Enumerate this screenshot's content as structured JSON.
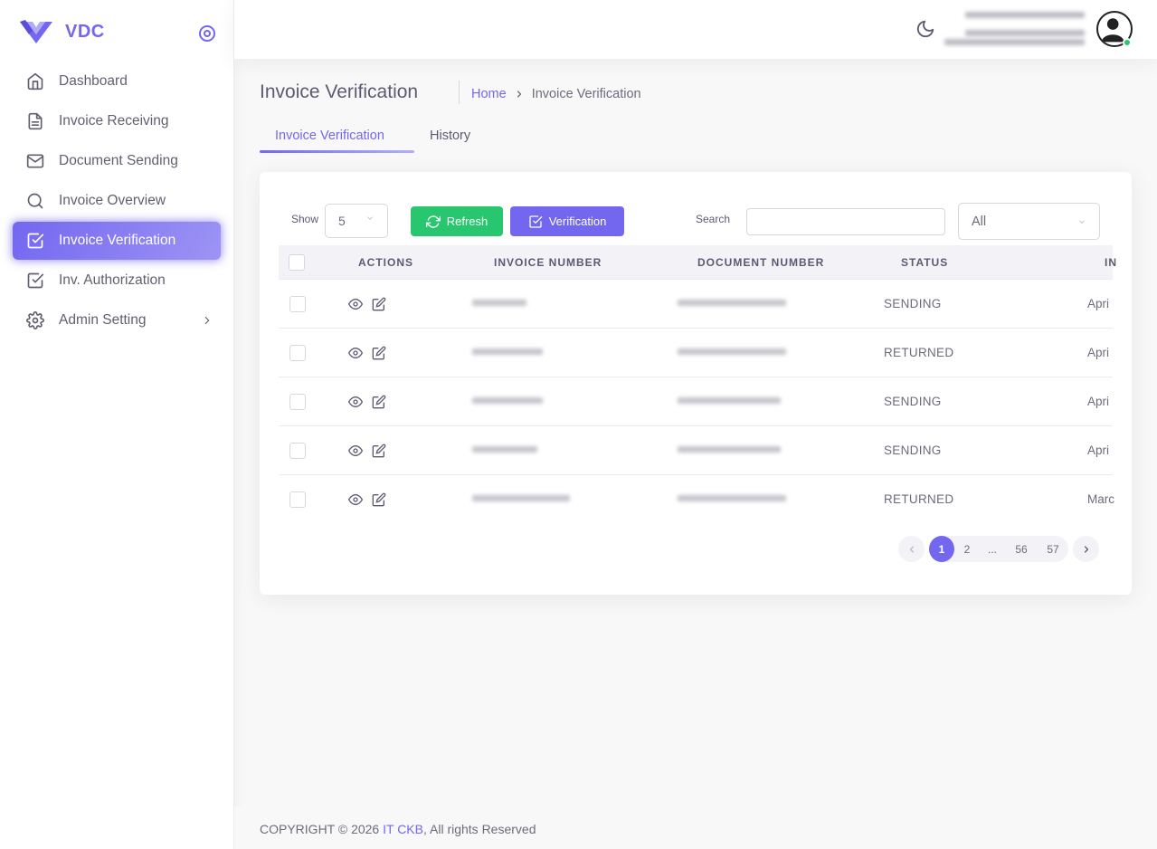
{
  "brand": {
    "name": "VDC"
  },
  "sidebar": {
    "items": [
      {
        "label": "Dashboard",
        "icon": "home-icon"
      },
      {
        "label": "Invoice Receiving",
        "icon": "file-text-icon"
      },
      {
        "label": "Document Sending",
        "icon": "mail-icon"
      },
      {
        "label": "Invoice Overview",
        "icon": "search-icon"
      },
      {
        "label": "Invoice Verification",
        "icon": "check-square-icon",
        "active": true
      },
      {
        "label": "Inv. Authorization",
        "icon": "check-square-icon"
      },
      {
        "label": "Admin Setting",
        "icon": "settings-icon",
        "has_submenu": true
      }
    ]
  },
  "header": {
    "theme_toggle": "moon-icon",
    "avatar_status": "online"
  },
  "page": {
    "title": "Invoice Verification",
    "breadcrumb": {
      "home": "Home",
      "current": "Invoice Verification"
    }
  },
  "tabs": [
    {
      "label": "Invoice Verification",
      "active": true
    },
    {
      "label": "History",
      "active": false
    }
  ],
  "toolbar": {
    "show_label": "Show",
    "page_size": "5",
    "refresh_label": "Refresh",
    "verification_label": "Verification",
    "search_label": "Search",
    "search_value": "",
    "filter_value": "All"
  },
  "table": {
    "columns": [
      "ACTIONS",
      "INVOICE NUMBER",
      "DOCUMENT NUMBER",
      "STATUS",
      "IN"
    ],
    "rows": [
      {
        "status": "SENDING",
        "date": "Apri"
      },
      {
        "status": "RETURNED",
        "date": "Apri"
      },
      {
        "status": "SENDING",
        "date": "Apri"
      },
      {
        "status": "SENDING",
        "date": "Apri"
      },
      {
        "status": "RETURNED",
        "date": "Marc"
      }
    ]
  },
  "pagination": {
    "pages": [
      "1",
      "2",
      "...",
      "56",
      "57"
    ],
    "current": "1"
  },
  "footer": {
    "prefix": "COPYRIGHT © 2026 ",
    "company": "IT CKB",
    "suffix": ", All rights Reserved"
  },
  "colors": {
    "primary": "#7367f0",
    "success": "#28c76f",
    "text": "#6e6b7b",
    "heading": "#5e5873"
  }
}
